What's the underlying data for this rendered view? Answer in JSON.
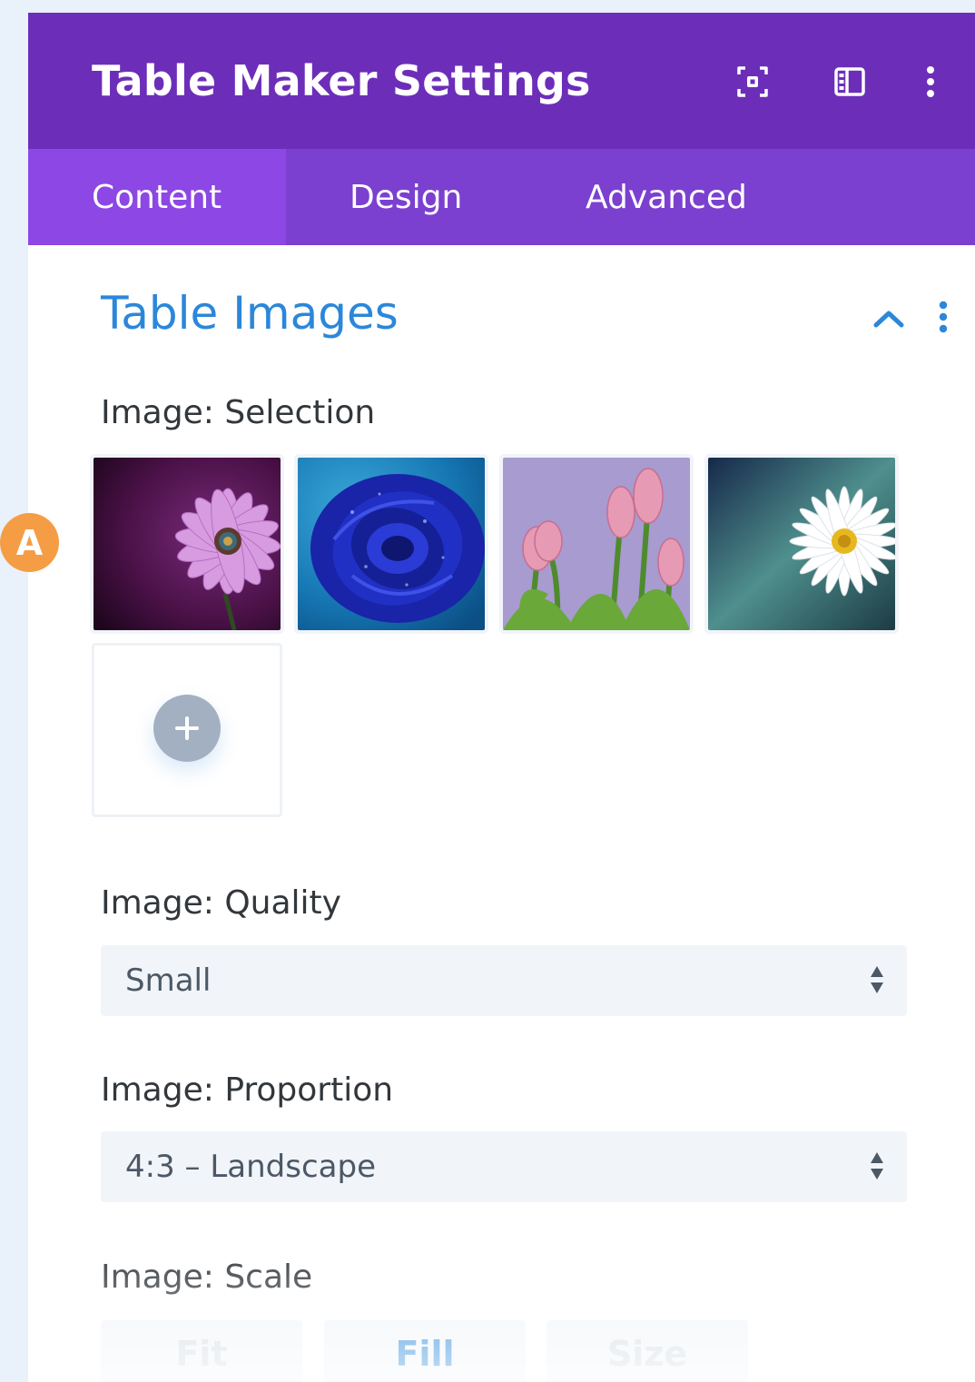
{
  "header": {
    "title": "Table Maker Settings",
    "icons": [
      "focus-icon",
      "sidebar-layout-icon",
      "more-vertical-icon"
    ],
    "background": "#6c2eb9"
  },
  "tabs": [
    {
      "label": "Content",
      "active": true
    },
    {
      "label": "Design",
      "active": false
    },
    {
      "label": "Advanced",
      "active": false
    }
  ],
  "section": {
    "title": "Table Images",
    "accent": "#2b87da"
  },
  "selection": {
    "label": "Image: Selection",
    "images": [
      "purple-daisy",
      "blue-rose",
      "pink-tulips",
      "white-daisy"
    ],
    "add_icon": "plus-icon"
  },
  "quality": {
    "label": "Image: Quality",
    "value": "Small"
  },
  "proportion": {
    "label": "Image: Proportion",
    "value": "4:3 – Landscape"
  },
  "scale": {
    "label": "Image: Scale",
    "options": [
      "Fit",
      "Fill",
      "Size"
    ],
    "selected": "Fill"
  },
  "annotation": {
    "badge": "A",
    "color": "#f59d45"
  }
}
